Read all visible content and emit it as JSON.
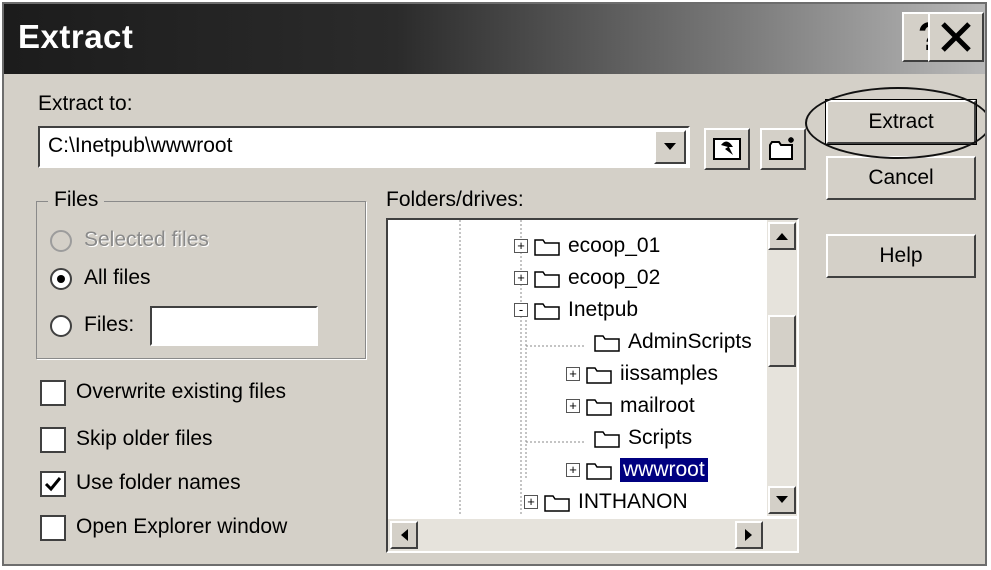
{
  "window": {
    "title": "Extract",
    "help_icon": "?",
    "close_icon": "X"
  },
  "extract_to": {
    "label": "Extract to:",
    "value": "C:\\Inetpub\\wwwroot"
  },
  "files_group": {
    "title": "Files",
    "options": [
      {
        "label": "Selected files",
        "state": "disabled"
      },
      {
        "label": "All files",
        "state": "checked"
      },
      {
        "label": "Files:",
        "state": "unchecked"
      }
    ],
    "files_value": ""
  },
  "checkboxes": [
    {
      "label": "Overwrite existing files",
      "checked": false
    },
    {
      "label": "Skip older files",
      "checked": false
    },
    {
      "label": "Use folder names",
      "checked": true
    },
    {
      "label": "Open Explorer window",
      "checked": false
    }
  ],
  "folders": {
    "label": "Folders/drives:",
    "items": [
      {
        "name": "ecoop_01",
        "expander": "+",
        "selected": false
      },
      {
        "name": "ecoop_02",
        "expander": "+",
        "selected": false
      },
      {
        "name": "Inetpub",
        "expander": "-",
        "selected": false
      },
      {
        "name": "AdminScripts",
        "expander": "",
        "selected": false
      },
      {
        "name": "iissamples",
        "expander": "+",
        "selected": false
      },
      {
        "name": "mailroot",
        "expander": "+",
        "selected": false
      },
      {
        "name": "Scripts",
        "expander": "",
        "selected": false
      },
      {
        "name": "wwwroot",
        "expander": "+",
        "selected": true
      },
      {
        "name": "INTHANON",
        "expander": "+",
        "selected": false
      }
    ]
  },
  "buttons": {
    "extract": "Extract",
    "cancel": "Cancel",
    "help": "Help"
  },
  "colors": {
    "dialog_bg": "#d4d0c8",
    "selection": "#000080"
  }
}
